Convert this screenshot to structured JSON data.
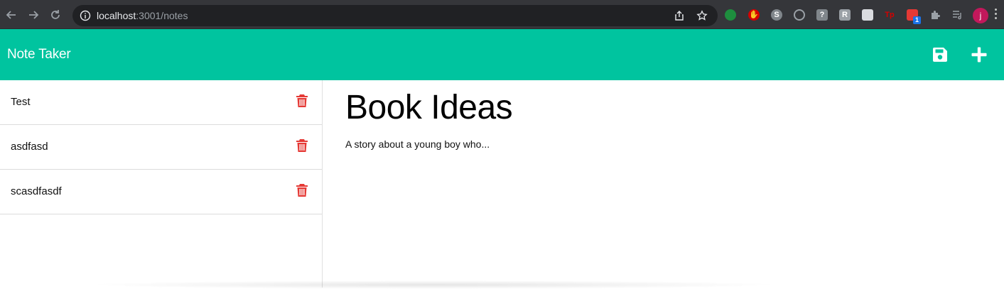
{
  "browser": {
    "url_host": "localhost",
    "url_path": ":3001/notes",
    "profile_initial": "j",
    "extension_badge": "1"
  },
  "app": {
    "title": "Note Taker",
    "accent_color": "#00c49f",
    "delete_color": "#e53935"
  },
  "notes": [
    {
      "title": "Test"
    },
    {
      "title": "asdfasd"
    },
    {
      "title": "scasdfasdf"
    }
  ],
  "active_note": {
    "title": "Book Ideas",
    "text": "A story about a young boy who..."
  },
  "icons": {
    "back": "arrow-left-icon",
    "forward": "arrow-right-icon",
    "reload": "reload-icon",
    "save": "floppy-disk-icon",
    "new": "plus-icon",
    "delete": "trash-icon"
  }
}
